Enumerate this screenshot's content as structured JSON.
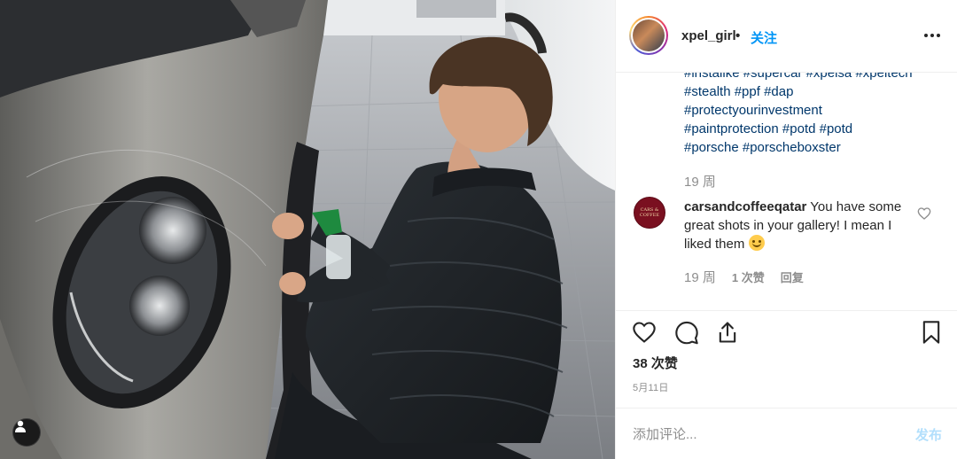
{
  "post": {
    "username": "xpel_girl",
    "separator": "•",
    "follow_label": "关注"
  },
  "caption": {
    "hashtag_lines": [
      "#instalike #supercar #xpelsa #xpeltech",
      "#stealth #ppf #dap",
      "#protectyourinvestment",
      "#paintprotection #potd #potd",
      "#porsche #porscheboxster"
    ],
    "time": "19 周"
  },
  "comment": {
    "username": "carsandcoffeeqatar",
    "text": " You have some great shots in your gallery! I mean I liked them ",
    "avatar_text": "CARS & COFFEE",
    "time": "19 周",
    "likes": "1 次赞",
    "reply": "回复"
  },
  "actions": {
    "like_icon": "heart-outline",
    "comment_icon": "speech-bubble",
    "share_icon": "share-arrow",
    "save_icon": "bookmark-outline"
  },
  "likes_count": "38 次赞",
  "date": "5月11日",
  "comment_box": {
    "placeholder": "添加评论...",
    "post_label": "发布"
  },
  "colors": {
    "link": "#00376b",
    "follow": "#0095f6",
    "muted": "#8e8e8e",
    "post_disabled": "#b2dffc"
  }
}
